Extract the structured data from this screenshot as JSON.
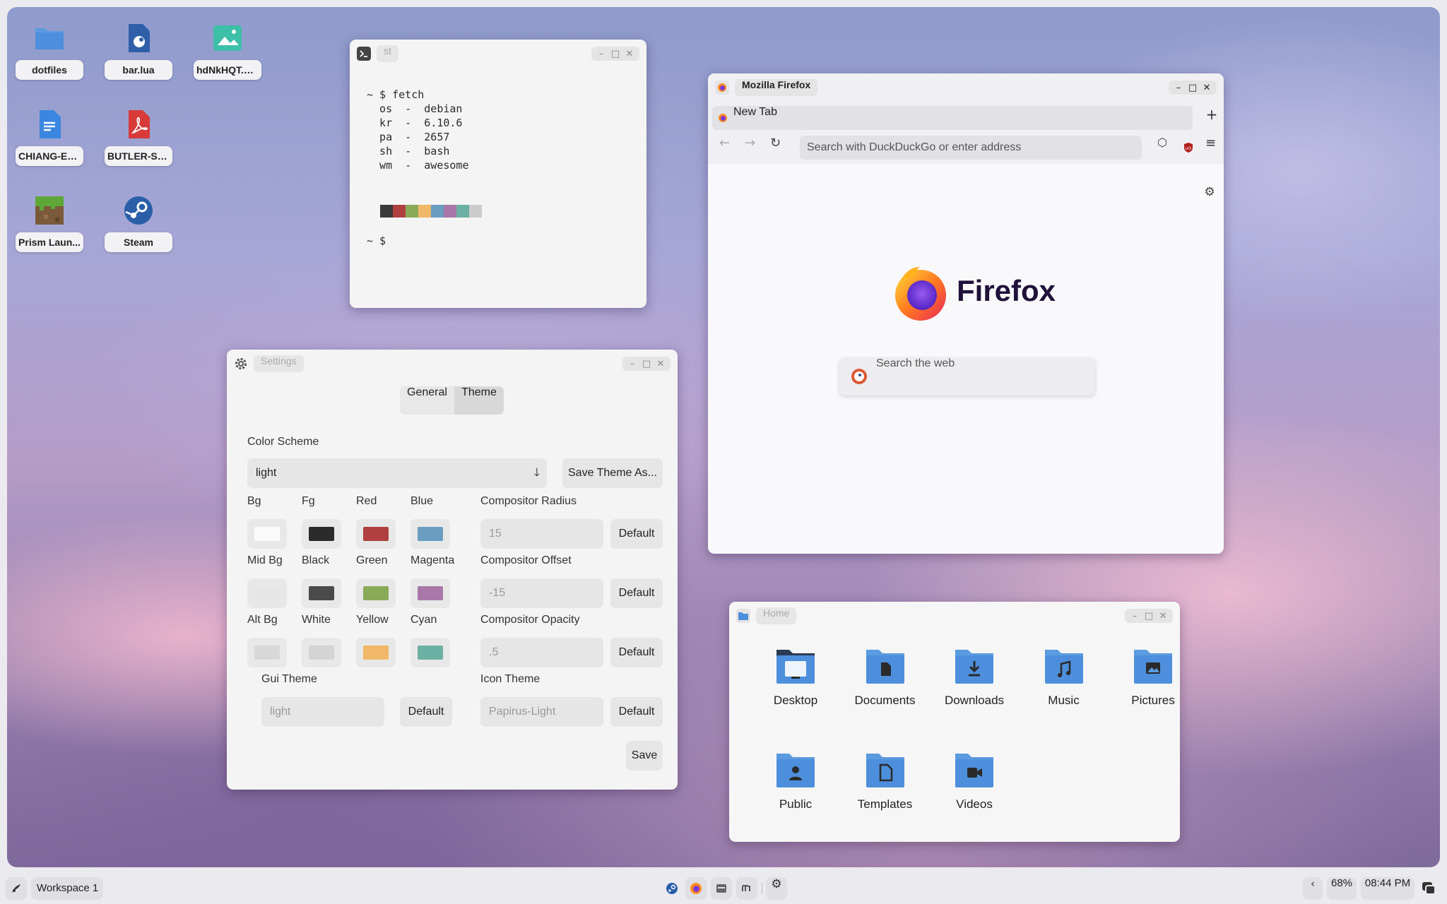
{
  "desktop": {
    "icons": [
      {
        "label": "dotfiles",
        "icon": "folder-icon"
      },
      {
        "label": "bar.lua",
        "icon": "lua-file-icon"
      },
      {
        "label": "hdNkHQT.png",
        "icon": "image-file-icon"
      },
      {
        "label": "CHIANG-Ex...",
        "icon": "document-file-icon"
      },
      {
        "label": "BUTLER-Sp...",
        "icon": "pdf-file-icon"
      },
      {
        "label": "Prism Laun...",
        "icon": "minecraft-grass-icon"
      },
      {
        "label": "Steam",
        "icon": "steam-icon"
      }
    ]
  },
  "terminal": {
    "title": "st",
    "lines": [
      "~ $ fetch",
      "",
      "  os  -  debian",
      "  kr  -  6.10.6",
      "  pa  -  2657",
      "  sh  -  bash",
      "  wm  -  awesome"
    ],
    "prompt": "~ $",
    "palette": [
      "#3a3a3a",
      "#b04040",
      "#8aaa58",
      "#f0b868",
      "#6a9ec0",
      "#a878a8",
      "#6cb0a4",
      "#cccccc"
    ]
  },
  "settings": {
    "title": "Settings",
    "tabs": {
      "general": "General",
      "theme": "Theme"
    },
    "color_scheme_label": "Color Scheme",
    "color_scheme_value": "light",
    "save_theme_as": "Save Theme As...",
    "colors": {
      "bg": {
        "label": "Bg",
        "value": "#fafafa"
      },
      "fg": {
        "label": "Fg",
        "value": "#2b2b2b"
      },
      "red": {
        "label": "Red",
        "value": "#b04040"
      },
      "blue": {
        "label": "Blue",
        "value": "#6a9ec0"
      },
      "mid_bg": {
        "label": "Mid Bg",
        "value": "#e6e6e6"
      },
      "black": {
        "label": "Black",
        "value": "#4a4a4a"
      },
      "green": {
        "label": "Green",
        "value": "#8aaa58"
      },
      "magenta": {
        "label": "Magenta",
        "value": "#a878a8"
      },
      "alt_bg": {
        "label": "Alt Bg",
        "value": "#d8d8d8"
      },
      "white": {
        "label": "White",
        "value": "#d4d4d4"
      },
      "yellow": {
        "label": "Yellow",
        "value": "#f0b868"
      },
      "cyan": {
        "label": "Cyan",
        "value": "#6cb0a4"
      }
    },
    "compositor_radius": {
      "label": "Compositor Radius",
      "value": "15"
    },
    "compositor_offset": {
      "label": "Compositor Offset",
      "value": "-15"
    },
    "compositor_opacity": {
      "label": "Compositor Opacity",
      "value": ".5"
    },
    "gui_theme": {
      "label": "Gui Theme",
      "value": "light"
    },
    "icon_theme": {
      "label": "Icon Theme",
      "value": "Papirus-Light"
    },
    "default_label": "Default",
    "save_label": "Save"
  },
  "firefox": {
    "title": "Mozilla Firefox",
    "tab_label": "New Tab",
    "address_placeholder": "Search with DuckDuckGo or enter address",
    "brand": "Firefox",
    "search_placeholder": "Search the web"
  },
  "files": {
    "title": "Home",
    "items": [
      {
        "name": "Desktop",
        "icon": "desktop-folder-icon"
      },
      {
        "name": "Documents",
        "icon": "documents-folder-icon"
      },
      {
        "name": "Downloads",
        "icon": "downloads-folder-icon"
      },
      {
        "name": "Music",
        "icon": "music-folder-icon"
      },
      {
        "name": "Pictures",
        "icon": "pictures-folder-icon"
      },
      {
        "name": "Public",
        "icon": "public-folder-icon"
      },
      {
        "name": "Templates",
        "icon": "templates-folder-icon"
      },
      {
        "name": "Videos",
        "icon": "videos-folder-icon"
      }
    ]
  },
  "taskbar": {
    "workspace": "Workspace 1",
    "volume": "68%",
    "clock": "08:44 PM"
  }
}
